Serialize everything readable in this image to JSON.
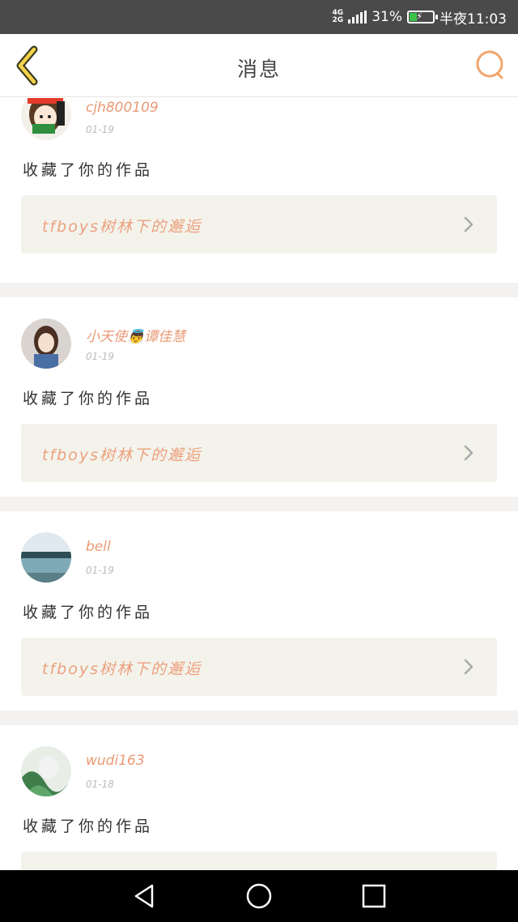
{
  "status_bar": {
    "net_top": "4G",
    "net_bottom": "2G",
    "battery_percent": "31%",
    "battery_level": 0.31,
    "time": "半夜11:03",
    "battery_color": "#3ac24a"
  },
  "header": {
    "title": "消息",
    "back_icon": "chevron-left-icon",
    "search_icon": "search-icon",
    "accent_color": "#f0a56d"
  },
  "messages": [
    {
      "user": "cjh800109",
      "date": "01-19",
      "action": "收藏了你的作品",
      "work_title": "tfboys树林下的邂逅"
    },
    {
      "user": "小天使👼谭佳慧",
      "date": "01-19",
      "action": "收藏了你的作品",
      "work_title": "tfboys树林下的邂逅"
    },
    {
      "user": "bell",
      "date": "01-19",
      "action": "收藏了你的作品",
      "work_title": "tfboys树林下的邂逅"
    },
    {
      "user": "wudi163",
      "date": "01-18",
      "action": "收藏了你的作品",
      "work_title": ""
    }
  ],
  "nav_bar": {
    "back_icon": "triangle-back-icon",
    "home_icon": "circle-home-icon",
    "recents_icon": "square-recents-icon"
  }
}
